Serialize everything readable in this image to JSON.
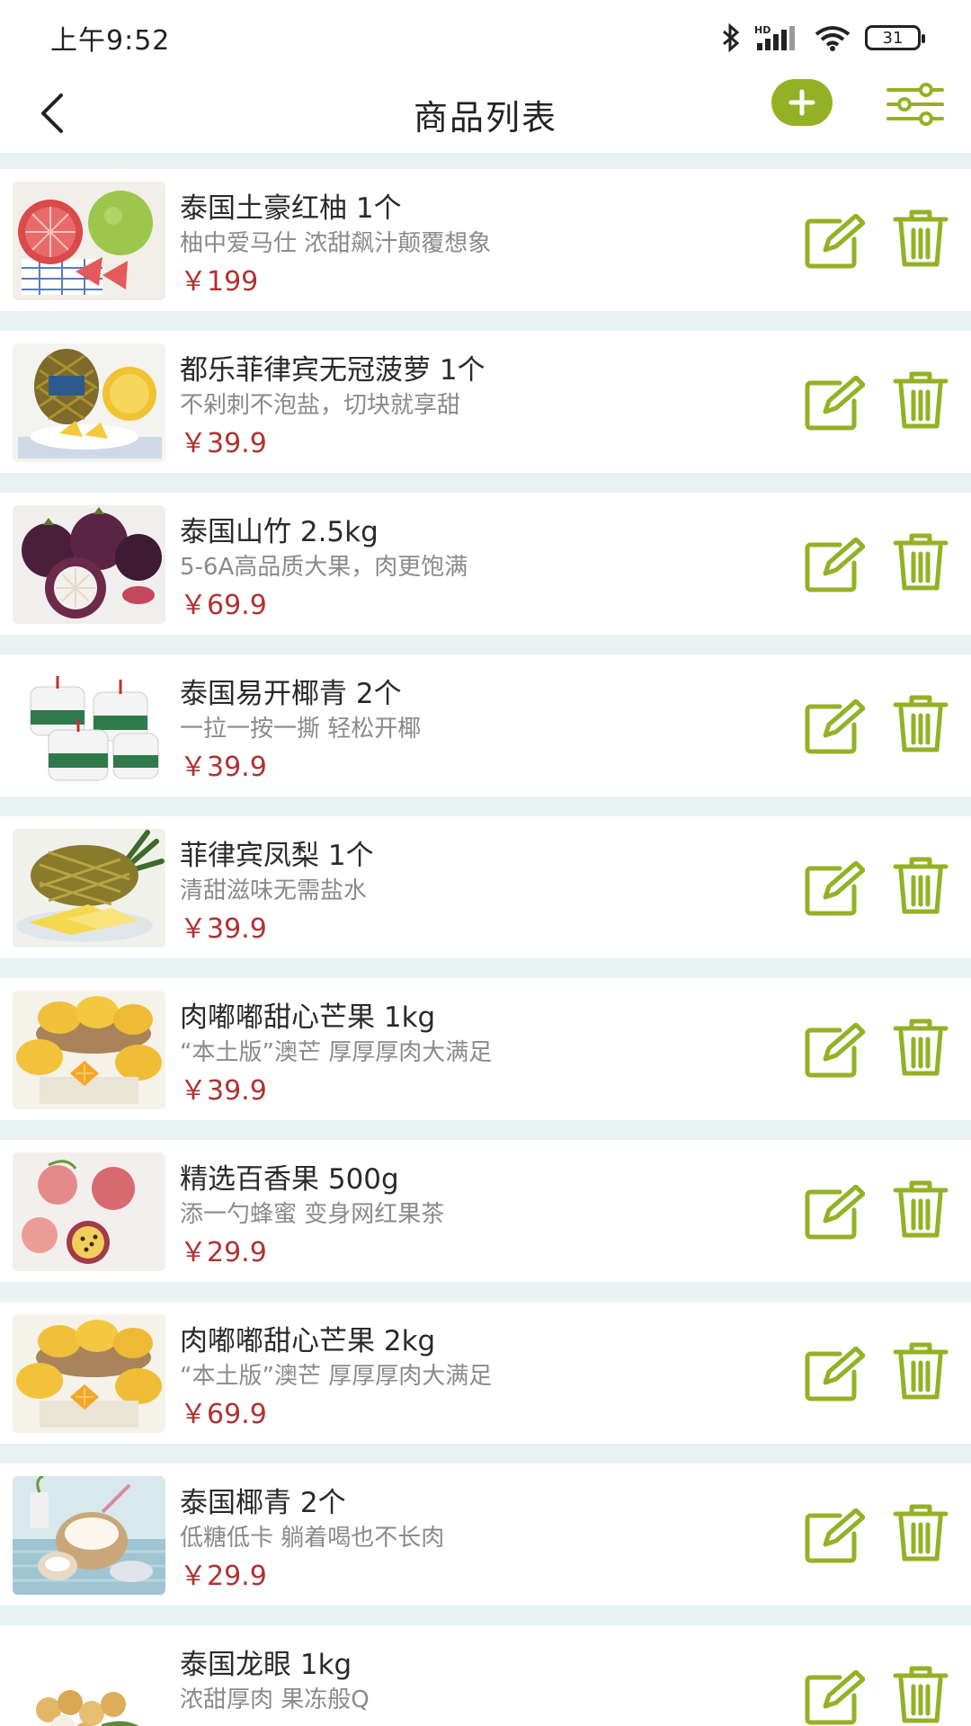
{
  "status_bar": {
    "time": "上午9:52",
    "network_label": "HD",
    "battery": "31",
    "icons": [
      "bluetooth-icon",
      "signal-icon",
      "wifi-icon",
      "battery-icon"
    ]
  },
  "nav": {
    "title": "商品列表",
    "icons": [
      "back-arrow-icon",
      "plus-icon",
      "filter-sliders-icon"
    ]
  },
  "colors": {
    "accent": "#94b125",
    "price": "#b03232",
    "background": "#e8f3f1"
  },
  "products": [
    {
      "name": "泰国土豪红柚 1个",
      "desc": "柚中爱马仕 浓甜飙汁颠覆想象",
      "price": "￥199",
      "image": "pomelo"
    },
    {
      "name": "都乐菲律宾无冠菠萝 1个",
      "desc": "不剁刺不泡盐，切块就享甜",
      "price": "￥39.9",
      "image": "pineapple-crownless"
    },
    {
      "name": "泰国山竹 2.5kg",
      "desc": "5-6A高品质大果，肉更饱满",
      "price": "￥69.9",
      "image": "mangosteen"
    },
    {
      "name": "泰国易开椰青 2个",
      "desc": "一拉一按一撕 轻松开椰",
      "price": "￥39.9",
      "image": "coconut-packed"
    },
    {
      "name": "菲律宾凤梨 1个",
      "desc": "清甜滋味无需盐水",
      "price": "￥39.9",
      "image": "pineapple"
    },
    {
      "name": "肉嘟嘟甜心芒果 1kg",
      "desc": "“本土版”澳芒 厚厚厚肉大满足",
      "price": "￥39.9",
      "image": "mango"
    },
    {
      "name": "精选百香果 500g",
      "desc": "添一勺蜂蜜 变身网红果茶",
      "price": "￥29.9",
      "image": "passion-fruit"
    },
    {
      "name": "肉嘟嘟甜心芒果 2kg",
      "desc": "“本土版”澳芒 厚厚厚肉大满足",
      "price": "￥69.9",
      "image": "mango"
    },
    {
      "name": "泰国椰青 2个",
      "desc": "低糖低卡 躺着喝也不长肉",
      "price": "￥29.9",
      "image": "coconut"
    },
    {
      "name": "泰国龙眼 1kg",
      "desc": "浓甜厚肉 果冻般Q",
      "price": "",
      "image": "longan"
    }
  ]
}
